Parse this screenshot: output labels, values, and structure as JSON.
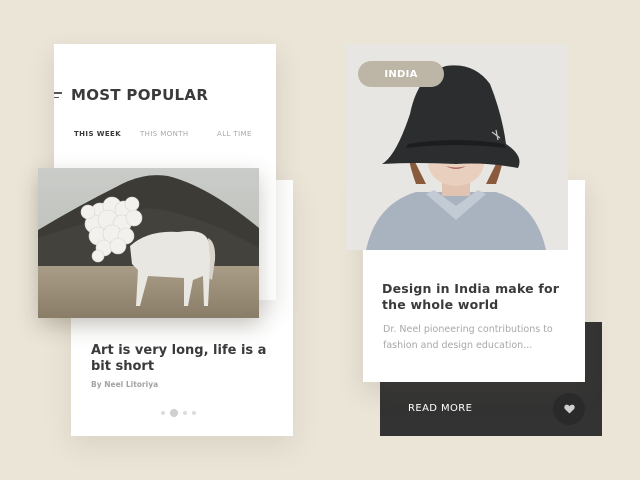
{
  "left_card": {
    "header": "MOST POPULAR",
    "tabs": [
      {
        "label": "THIS WEEK",
        "active": true
      },
      {
        "label": "THIS MONTH",
        "active": false
      },
      {
        "label": "ALL TIME",
        "active": false
      }
    ],
    "article": {
      "title": "Art is very long, life is a bit short",
      "author": "By Neel Litoriya"
    },
    "pagination": {
      "count": 4,
      "active_index": 1
    }
  },
  "right_card": {
    "badge": "INDIA",
    "title": "Design in India make for the whole world",
    "description": "Dr. Neel pioneering contributions to fashion and design education...",
    "read_more_label": "READ MORE",
    "like_icon": "heart-icon"
  },
  "colors": {
    "background": "#ebe5d8",
    "badge": "#bdb5a6",
    "dark_panel": "#333333"
  }
}
